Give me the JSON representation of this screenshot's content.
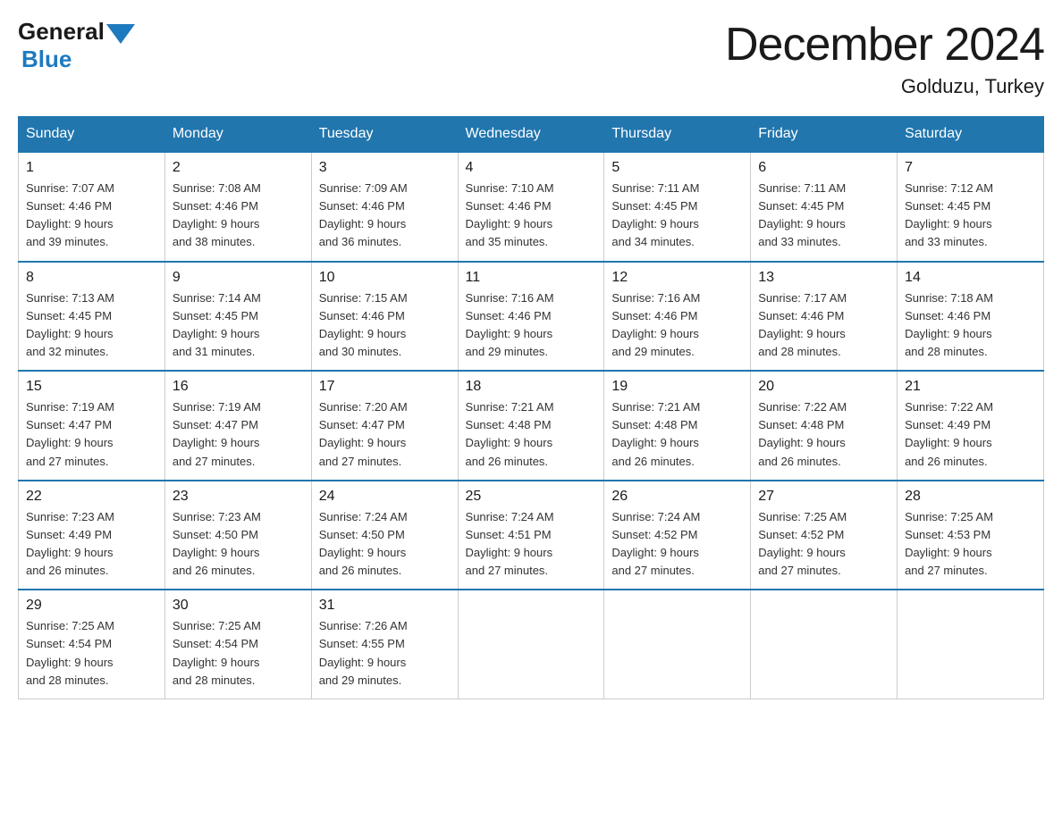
{
  "logo": {
    "general": "General",
    "blue": "Blue"
  },
  "title": "December 2024",
  "location": "Golduzu, Turkey",
  "days_of_week": [
    "Sunday",
    "Monday",
    "Tuesday",
    "Wednesday",
    "Thursday",
    "Friday",
    "Saturday"
  ],
  "weeks": [
    [
      {
        "day": "1",
        "sunrise": "7:07 AM",
        "sunset": "4:46 PM",
        "daylight": "9 hours and 39 minutes."
      },
      {
        "day": "2",
        "sunrise": "7:08 AM",
        "sunset": "4:46 PM",
        "daylight": "9 hours and 38 minutes."
      },
      {
        "day": "3",
        "sunrise": "7:09 AM",
        "sunset": "4:46 PM",
        "daylight": "9 hours and 36 minutes."
      },
      {
        "day": "4",
        "sunrise": "7:10 AM",
        "sunset": "4:46 PM",
        "daylight": "9 hours and 35 minutes."
      },
      {
        "day": "5",
        "sunrise": "7:11 AM",
        "sunset": "4:45 PM",
        "daylight": "9 hours and 34 minutes."
      },
      {
        "day": "6",
        "sunrise": "7:11 AM",
        "sunset": "4:45 PM",
        "daylight": "9 hours and 33 minutes."
      },
      {
        "day": "7",
        "sunrise": "7:12 AM",
        "sunset": "4:45 PM",
        "daylight": "9 hours and 33 minutes."
      }
    ],
    [
      {
        "day": "8",
        "sunrise": "7:13 AM",
        "sunset": "4:45 PM",
        "daylight": "9 hours and 32 minutes."
      },
      {
        "day": "9",
        "sunrise": "7:14 AM",
        "sunset": "4:45 PM",
        "daylight": "9 hours and 31 minutes."
      },
      {
        "day": "10",
        "sunrise": "7:15 AM",
        "sunset": "4:46 PM",
        "daylight": "9 hours and 30 minutes."
      },
      {
        "day": "11",
        "sunrise": "7:16 AM",
        "sunset": "4:46 PM",
        "daylight": "9 hours and 29 minutes."
      },
      {
        "day": "12",
        "sunrise": "7:16 AM",
        "sunset": "4:46 PM",
        "daylight": "9 hours and 29 minutes."
      },
      {
        "day": "13",
        "sunrise": "7:17 AM",
        "sunset": "4:46 PM",
        "daylight": "9 hours and 28 minutes."
      },
      {
        "day": "14",
        "sunrise": "7:18 AM",
        "sunset": "4:46 PM",
        "daylight": "9 hours and 28 minutes."
      }
    ],
    [
      {
        "day": "15",
        "sunrise": "7:19 AM",
        "sunset": "4:47 PM",
        "daylight": "9 hours and 27 minutes."
      },
      {
        "day": "16",
        "sunrise": "7:19 AM",
        "sunset": "4:47 PM",
        "daylight": "9 hours and 27 minutes."
      },
      {
        "day": "17",
        "sunrise": "7:20 AM",
        "sunset": "4:47 PM",
        "daylight": "9 hours and 27 minutes."
      },
      {
        "day": "18",
        "sunrise": "7:21 AM",
        "sunset": "4:48 PM",
        "daylight": "9 hours and 26 minutes."
      },
      {
        "day": "19",
        "sunrise": "7:21 AM",
        "sunset": "4:48 PM",
        "daylight": "9 hours and 26 minutes."
      },
      {
        "day": "20",
        "sunrise": "7:22 AM",
        "sunset": "4:48 PM",
        "daylight": "9 hours and 26 minutes."
      },
      {
        "day": "21",
        "sunrise": "7:22 AM",
        "sunset": "4:49 PM",
        "daylight": "9 hours and 26 minutes."
      }
    ],
    [
      {
        "day": "22",
        "sunrise": "7:23 AM",
        "sunset": "4:49 PM",
        "daylight": "9 hours and 26 minutes."
      },
      {
        "day": "23",
        "sunrise": "7:23 AM",
        "sunset": "4:50 PM",
        "daylight": "9 hours and 26 minutes."
      },
      {
        "day": "24",
        "sunrise": "7:24 AM",
        "sunset": "4:50 PM",
        "daylight": "9 hours and 26 minutes."
      },
      {
        "day": "25",
        "sunrise": "7:24 AM",
        "sunset": "4:51 PM",
        "daylight": "9 hours and 27 minutes."
      },
      {
        "day": "26",
        "sunrise": "7:24 AM",
        "sunset": "4:52 PM",
        "daylight": "9 hours and 27 minutes."
      },
      {
        "day": "27",
        "sunrise": "7:25 AM",
        "sunset": "4:52 PM",
        "daylight": "9 hours and 27 minutes."
      },
      {
        "day": "28",
        "sunrise": "7:25 AM",
        "sunset": "4:53 PM",
        "daylight": "9 hours and 27 minutes."
      }
    ],
    [
      {
        "day": "29",
        "sunrise": "7:25 AM",
        "sunset": "4:54 PM",
        "daylight": "9 hours and 28 minutes."
      },
      {
        "day": "30",
        "sunrise": "7:25 AM",
        "sunset": "4:54 PM",
        "daylight": "9 hours and 28 minutes."
      },
      {
        "day": "31",
        "sunrise": "7:26 AM",
        "sunset": "4:55 PM",
        "daylight": "9 hours and 29 minutes."
      },
      null,
      null,
      null,
      null
    ]
  ],
  "labels": {
    "sunrise": "Sunrise:",
    "sunset": "Sunset:",
    "daylight": "Daylight:"
  }
}
